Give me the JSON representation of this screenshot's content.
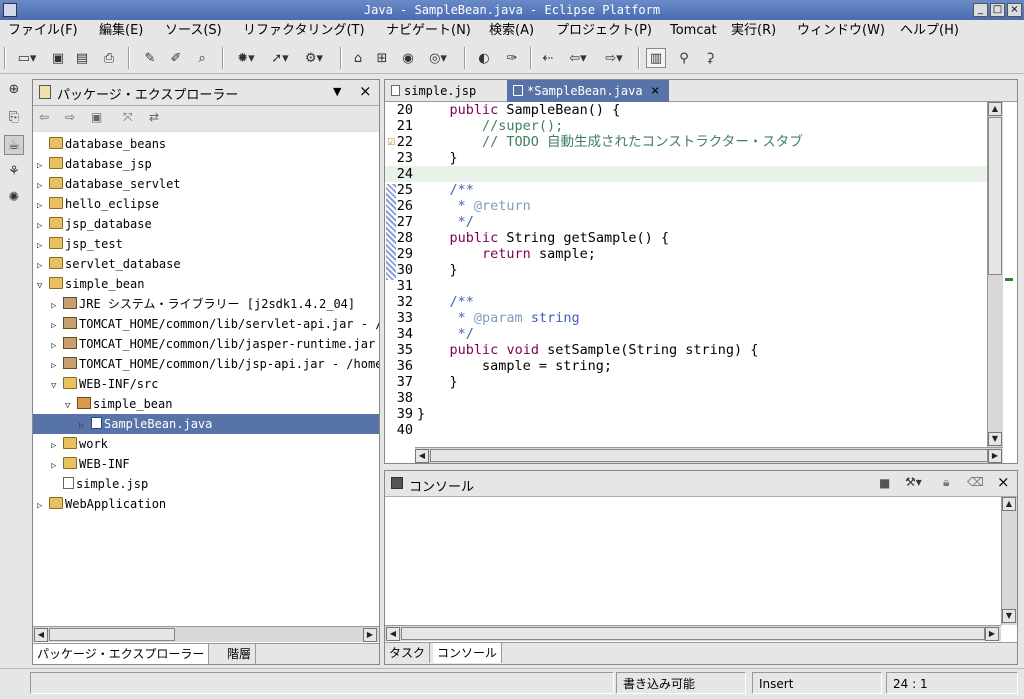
{
  "window": {
    "title": "Java - SampleBean.java - Eclipse Platform"
  },
  "menu": [
    "ファイル(F)",
    "編集(E)",
    "ソース(S)",
    "リファクタリング(T)",
    "ナビゲート(N)",
    "検索(A)",
    "プロジェクト(P)",
    "Tomcat",
    "実行(R)",
    "ウィンドウ(W)",
    "ヘルプ(H)"
  ],
  "package_explorer": {
    "title": "パッケージ・エクスプローラー",
    "tree": [
      {
        "label": "database_beans",
        "depth": 0,
        "twisty": "",
        "icon": "project"
      },
      {
        "label": "database_jsp",
        "depth": 0,
        "twisty": "▷",
        "icon": "project"
      },
      {
        "label": "database_servlet",
        "depth": 0,
        "twisty": "▷",
        "icon": "project"
      },
      {
        "label": "hello_eclipse",
        "depth": 0,
        "twisty": "▷",
        "icon": "project"
      },
      {
        "label": "jsp_database",
        "depth": 0,
        "twisty": "▷",
        "icon": "project"
      },
      {
        "label": "jsp_test",
        "depth": 0,
        "twisty": "▷",
        "icon": "project"
      },
      {
        "label": "servlet_database",
        "depth": 0,
        "twisty": "▷",
        "icon": "project"
      },
      {
        "label": "simple_bean",
        "depth": 0,
        "twisty": "▽",
        "icon": "project"
      },
      {
        "label": "JRE システム・ライブラリー [j2sdk1.4.2_04]",
        "depth": 1,
        "twisty": "▷",
        "icon": "library"
      },
      {
        "label": "TOMCAT_HOME/common/lib/servlet-api.jar - /h",
        "depth": 1,
        "twisty": "▷",
        "icon": "library"
      },
      {
        "label": "TOMCAT_HOME/common/lib/jasper-runtime.jar -",
        "depth": 1,
        "twisty": "▷",
        "icon": "library"
      },
      {
        "label": "TOMCAT_HOME/common/lib/jsp-api.jar - /home/",
        "depth": 1,
        "twisty": "▷",
        "icon": "library"
      },
      {
        "label": "WEB-INF/src",
        "depth": 1,
        "twisty": "▽",
        "icon": "project"
      },
      {
        "label": "simple_bean",
        "depth": 2,
        "twisty": "▽",
        "icon": "package"
      },
      {
        "label": "SampleBean.java",
        "depth": 3,
        "twisty": "▷",
        "icon": "java",
        "selected": true
      },
      {
        "label": "work",
        "depth": 1,
        "twisty": "▷",
        "icon": "project"
      },
      {
        "label": "WEB-INF",
        "depth": 1,
        "twisty": "▷",
        "icon": "project"
      },
      {
        "label": "simple.jsp",
        "depth": 1,
        "twisty": "",
        "icon": "file"
      },
      {
        "label": "WebApplication",
        "depth": 0,
        "twisty": "▷",
        "icon": "project"
      }
    ],
    "bottom_tabs": [
      "パッケージ・エクスプローラー",
      "階層"
    ]
  },
  "editor": {
    "tabs": [
      {
        "label": "simple.jsp",
        "active": false
      },
      {
        "label": "*SampleBean.java",
        "active": true
      }
    ],
    "lines": [
      {
        "n": "20",
        "parts": [
          [
            "",
            "    "
          ],
          [
            "kw",
            "public"
          ],
          [
            "",
            " SampleBean() {"
          ]
        ]
      },
      {
        "n": "21",
        "parts": [
          [
            "",
            "        "
          ],
          [
            "cm",
            "//super();"
          ]
        ]
      },
      {
        "n": "22",
        "parts": [
          [
            "",
            "        "
          ],
          [
            "cm",
            "// TODO 自動生成されたコンストラクター・スタブ"
          ]
        ]
      },
      {
        "n": "23",
        "parts": [
          [
            "",
            "    }"
          ]
        ]
      },
      {
        "n": "24",
        "parts": [
          [
            "",
            ""
          ]
        ],
        "highlight": true
      },
      {
        "n": "25",
        "parts": [
          [
            "",
            "    "
          ],
          [
            "jd",
            "/**"
          ]
        ]
      },
      {
        "n": "26",
        "parts": [
          [
            "",
            "     "
          ],
          [
            "jd",
            "* "
          ],
          [
            "jt",
            "@return"
          ]
        ]
      },
      {
        "n": "27",
        "parts": [
          [
            "",
            "     "
          ],
          [
            "jd",
            "*/"
          ]
        ]
      },
      {
        "n": "28",
        "parts": [
          [
            "",
            "    "
          ],
          [
            "kw",
            "public"
          ],
          [
            "",
            " String getSample() {"
          ]
        ]
      },
      {
        "n": "29",
        "parts": [
          [
            "",
            "        "
          ],
          [
            "kw",
            "return"
          ],
          [
            "",
            " sample;"
          ]
        ]
      },
      {
        "n": "30",
        "parts": [
          [
            "",
            "    }"
          ]
        ]
      },
      {
        "n": "31",
        "parts": [
          [
            "",
            ""
          ]
        ]
      },
      {
        "n": "32",
        "parts": [
          [
            "",
            "    "
          ],
          [
            "jd",
            "/**"
          ]
        ]
      },
      {
        "n": "33",
        "parts": [
          [
            "",
            "     "
          ],
          [
            "jd",
            "* "
          ],
          [
            "jt",
            "@param"
          ],
          [
            "jd",
            " string"
          ]
        ]
      },
      {
        "n": "34",
        "parts": [
          [
            "",
            "     "
          ],
          [
            "jd",
            "*/"
          ]
        ]
      },
      {
        "n": "35",
        "parts": [
          [
            "",
            "    "
          ],
          [
            "kw",
            "public"
          ],
          [
            "",
            " "
          ],
          [
            "kw",
            "void"
          ],
          [
            "",
            " setSample(String string) {"
          ]
        ]
      },
      {
        "n": "36",
        "parts": [
          [
            "",
            "        sample = string;"
          ]
        ]
      },
      {
        "n": "37",
        "parts": [
          [
            "",
            "    }"
          ]
        ]
      },
      {
        "n": "38",
        "parts": [
          [
            "",
            ""
          ]
        ]
      },
      {
        "n": "39",
        "parts": [
          [
            "",
            "}"
          ]
        ]
      },
      {
        "n": "40",
        "parts": [
          [
            "",
            ""
          ]
        ]
      }
    ]
  },
  "console": {
    "title": "コンソール",
    "bottom_tabs": [
      "タスク",
      "コンソール"
    ]
  },
  "status": {
    "writable": "書き込み可能",
    "mode": "Insert",
    "position": "24 : 1"
  }
}
